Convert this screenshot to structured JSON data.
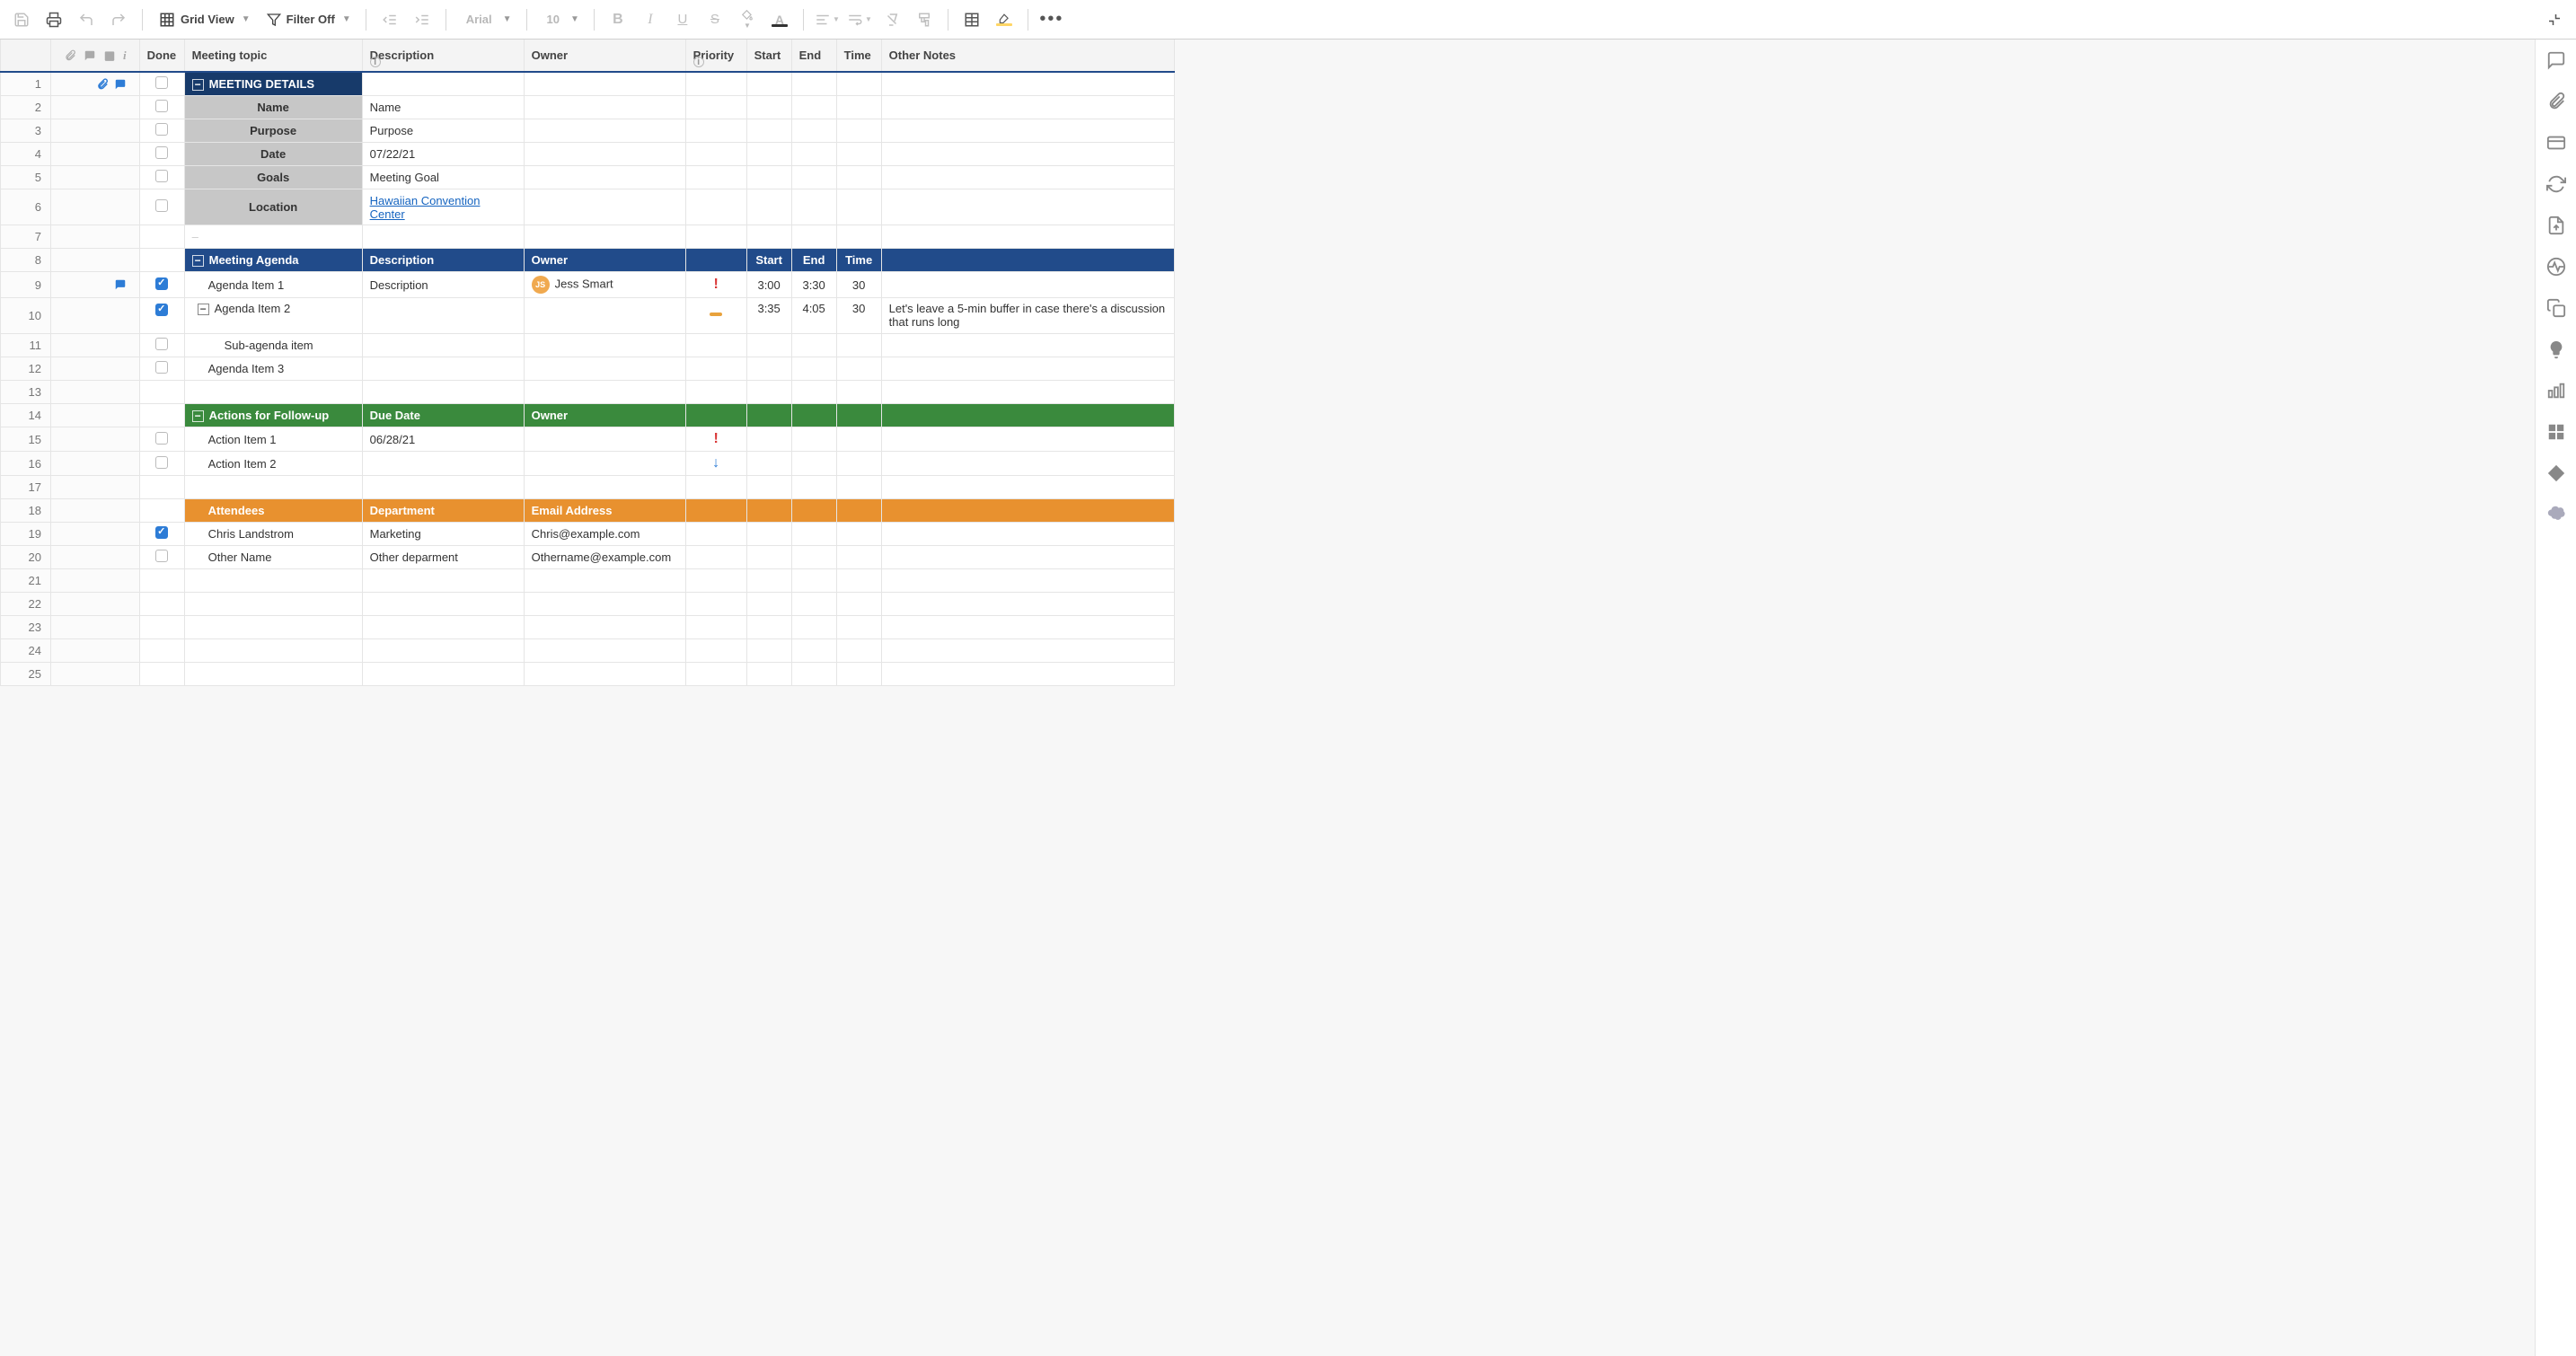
{
  "toolbar": {
    "view_label": "Grid View",
    "filter_label": "Filter Off",
    "font_label": "Arial",
    "fontsize_label": "10"
  },
  "columns": {
    "done": "Done",
    "topic": "Meeting topic",
    "desc": "Description",
    "owner": "Owner",
    "priority": "Priority",
    "start": "Start",
    "end": "End",
    "time": "Time",
    "notes": "Other Notes"
  },
  "sections": {
    "details": {
      "title": "MEETING DETAILS",
      "rows": [
        {
          "label": "Name",
          "desc": "Name"
        },
        {
          "label": "Purpose",
          "desc": "Purpose"
        },
        {
          "label": "Date",
          "desc": "07/22/21"
        },
        {
          "label": "Goals",
          "desc": "Meeting Goal"
        },
        {
          "label": "Location",
          "desc_link": "Hawaiian Convention Center"
        }
      ]
    },
    "agenda": {
      "title": "Meeting Agenda",
      "desc_h": "Description",
      "owner_h": "Owner",
      "start_h": "Start",
      "end_h": "End",
      "time_h": "Time",
      "rows": [
        {
          "topic": "Agenda Item 1",
          "desc": "Description",
          "owner_initials": "JS",
          "owner": "Jess Smart",
          "priority": "high",
          "start": "3:00",
          "end": "3:30",
          "time": "30",
          "done": true,
          "comment": true
        },
        {
          "topic": "Agenda Item 2",
          "priority": "med",
          "start": "3:35",
          "end": "4:05",
          "time": "30",
          "notes": "Let's leave a 5-min buffer in case there's a discussion that runs long",
          "done": true,
          "expandable": true
        },
        {
          "topic": "Sub-agenda item",
          "indent": 2,
          "done_box": true
        },
        {
          "topic": "Agenda Item 3",
          "done_box": true
        }
      ]
    },
    "actions": {
      "title": "Actions for Follow-up",
      "desc_h": "Due Date",
      "owner_h": "Owner",
      "rows": [
        {
          "topic": "Action Item 1",
          "desc": "06/28/21",
          "priority": "high",
          "done_box": true
        },
        {
          "topic": "Action Item 2",
          "priority": "low",
          "done_box": true
        }
      ]
    },
    "attendees": {
      "title": "Attendees",
      "desc_h": "Department",
      "owner_h": "Email Address",
      "rows": [
        {
          "topic": "Chris Landstrom",
          "desc": "Marketing",
          "owner": "Chris@example.com",
          "done": true
        },
        {
          "topic": "Other Name",
          "desc": "Other deparment",
          "owner": "Othername@example.com",
          "done_box": true
        }
      ]
    }
  },
  "row_numbers": [
    1,
    2,
    3,
    4,
    5,
    6,
    7,
    8,
    9,
    10,
    11,
    12,
    13,
    14,
    15,
    16,
    17,
    18,
    19,
    20,
    21,
    22,
    23,
    24,
    25
  ]
}
